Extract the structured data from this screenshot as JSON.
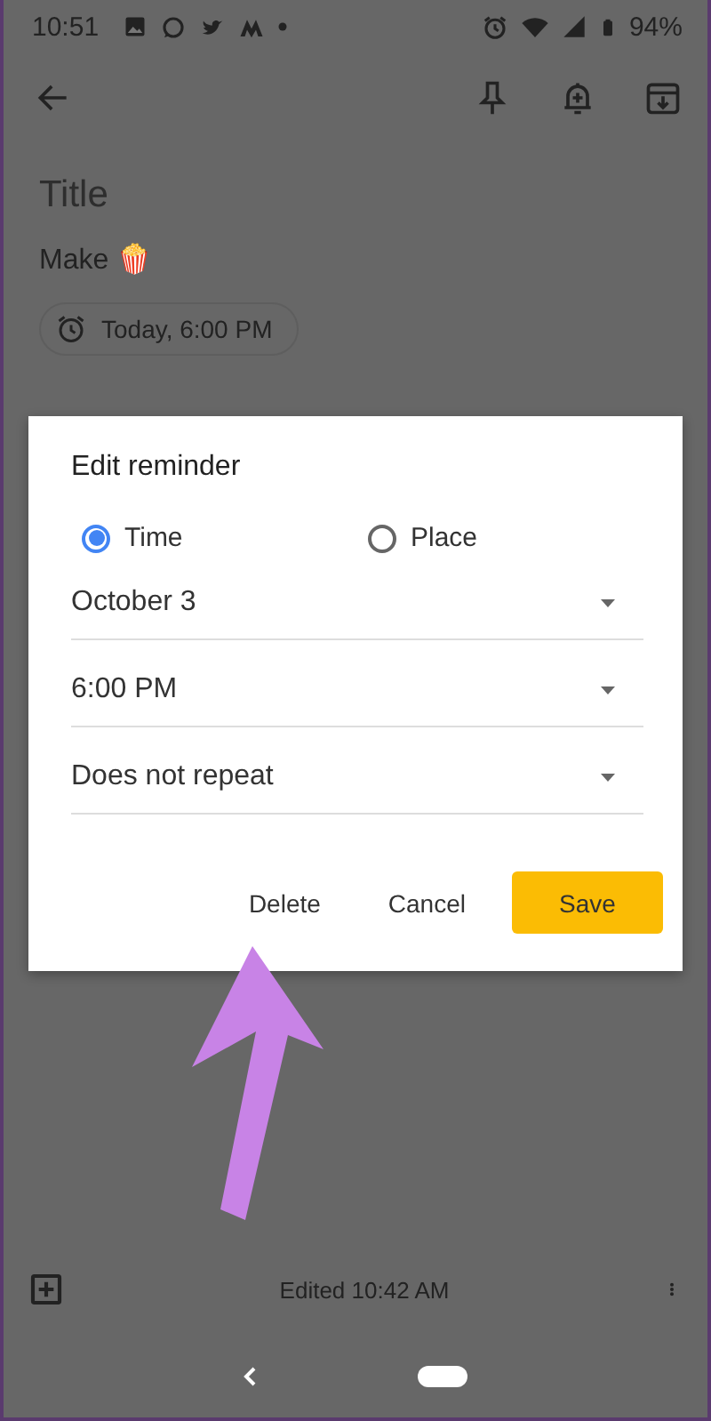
{
  "status_bar": {
    "time": "10:51",
    "battery": "94%"
  },
  "note": {
    "title_placeholder": "Title",
    "body": "Make 🍿",
    "reminder_chip": "Today, 6:00 PM"
  },
  "dialog": {
    "title": "Edit reminder",
    "options": [
      {
        "label": "Time",
        "selected": true
      },
      {
        "label": "Place",
        "selected": false
      }
    ],
    "dropdowns": [
      {
        "value": "October 3"
      },
      {
        "value": "6:00 PM"
      },
      {
        "value": "Does not repeat"
      }
    ],
    "buttons": [
      {
        "label": "Delete",
        "kind": "text"
      },
      {
        "label": "Cancel",
        "kind": "text"
      },
      {
        "label": "Save",
        "kind": "primary"
      }
    ]
  },
  "bottom_bar": {
    "status": "Edited 10:42 AM"
  }
}
